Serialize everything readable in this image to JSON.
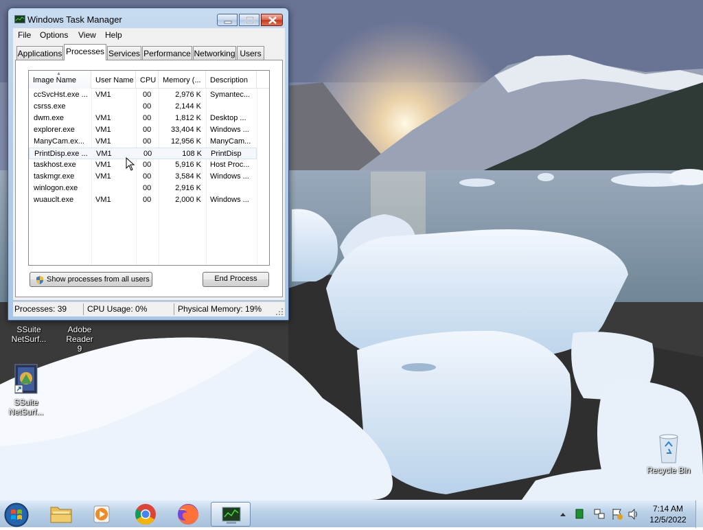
{
  "window": {
    "title": "Windows Task Manager",
    "menu": [
      "File",
      "Options",
      "View",
      "Help"
    ],
    "tabs": [
      "Applications",
      "Processes",
      "Services",
      "Performance",
      "Networking",
      "Users"
    ],
    "active_tab": "Processes"
  },
  "processes": {
    "columns": [
      "Image Name",
      "User Name",
      "CPU",
      "Memory (...",
      "Description"
    ],
    "rows": [
      {
        "name": "ccSvcHst.exe ...",
        "user": "VM1",
        "cpu": "00",
        "memory": "2,976 K",
        "description": "Symantec..."
      },
      {
        "name": "csrss.exe",
        "user": "",
        "cpu": "00",
        "memory": "2,144 K",
        "description": ""
      },
      {
        "name": "dwm.exe",
        "user": "VM1",
        "cpu": "00",
        "memory": "1,812 K",
        "description": "Desktop ..."
      },
      {
        "name": "explorer.exe",
        "user": "VM1",
        "cpu": "00",
        "memory": "33,404 K",
        "description": "Windows ..."
      },
      {
        "name": "ManyCam.ex...",
        "user": "VM1",
        "cpu": "00",
        "memory": "12,956 K",
        "description": "ManyCam..."
      },
      {
        "name": "PrintDisp.exe ...",
        "user": "VM1",
        "cpu": "00",
        "memory": "108 K",
        "description": "PrintDisp"
      },
      {
        "name": "taskhost.exe",
        "user": "VM1",
        "cpu": "00",
        "memory": "5,916 K",
        "description": "Host Proc..."
      },
      {
        "name": "taskmgr.exe",
        "user": "VM1",
        "cpu": "00",
        "memory": "3,584 K",
        "description": "Windows ..."
      },
      {
        "name": "winlogon.exe",
        "user": "",
        "cpu": "00",
        "memory": "2,916 K",
        "description": ""
      },
      {
        "name": "wuauclt.exe",
        "user": "VM1",
        "cpu": "00",
        "memory": "2,000 K",
        "description": "Windows ..."
      }
    ],
    "show_all_button": "Show processes from all users",
    "end_process_button": "End Process"
  },
  "status": {
    "processes": "Processes: 39",
    "cpu": "CPU Usage: 0%",
    "memory": "Physical Memory: 19%"
  },
  "desktop_icons": [
    {
      "label_line1": "SSuite",
      "label_line2": "NetSurf..."
    },
    {
      "label_line1": "Adobe Reader",
      "label_line2": "9"
    },
    {
      "label_line1": "SSuite",
      "label_line2": "NetSurf..."
    },
    {
      "label_line1": "Recycle Bin",
      "label_line2": ""
    }
  ],
  "taskbar": {
    "apps": [
      "start-orb",
      "file-explorer",
      "media-player",
      "chrome",
      "firefox",
      "task-manager"
    ],
    "clock_time": "7:14 AM",
    "clock_date": "12/5/2022"
  },
  "colors": {
    "selection": "#f4f7fc",
    "close_button": "#c4391f",
    "taskbar": "#b9d0e6"
  }
}
